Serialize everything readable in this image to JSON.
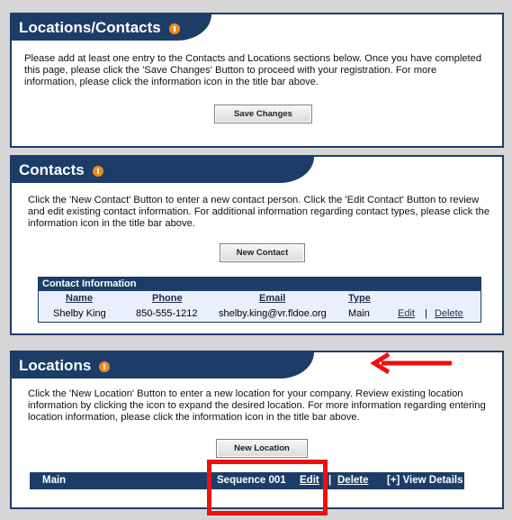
{
  "locations_contacts": {
    "title": "Locations/Contacts",
    "description": "Please add at least one entry to the Contacts and Locations sections below. Once you have completed this page, please click the 'Save Changes' Button to proceed with your registration. For more information, please click the information icon in the title bar above.",
    "save_button": "Save Changes"
  },
  "contacts": {
    "title": "Contacts",
    "description": "Click the 'New Contact' Button to enter a new contact person. Click the 'Edit Contact' Button to review and edit existing contact information. For additional information regarding contact types, please click the information icon in the title bar above.",
    "new_button": "New Contact",
    "table": {
      "title": "Contact Information",
      "headers": {
        "name": "Name",
        "phone": "Phone",
        "email": "Email",
        "type": "Type"
      },
      "rows": [
        {
          "name": "Shelby King",
          "phone": "850-555-1212",
          "email": "shelby.king@vr.fldoe.org",
          "type": "Main",
          "edit": "Edit",
          "separator": "|",
          "delete": "Delete"
        }
      ]
    }
  },
  "locations": {
    "title": "Locations",
    "description": "Click the 'New Location' Button to enter a new location for your company. Review existing location information by clicking the icon to expand the desired location. For more information regarding entering location information, please click the information icon in the title bar above.",
    "new_button": "New Location",
    "row": {
      "name": "Main",
      "sequence": "Sequence 001",
      "edit": "Edit",
      "separator": "|",
      "delete": "Delete",
      "view_details": "[+] View Details"
    }
  },
  "colors": {
    "header_navy": "#1c3d68",
    "info_orange": "#f08a1e",
    "annotation_red": "#ee1111"
  },
  "icons": [
    "info-icon",
    "red-arrow-annotation",
    "red-highlight-box"
  ]
}
